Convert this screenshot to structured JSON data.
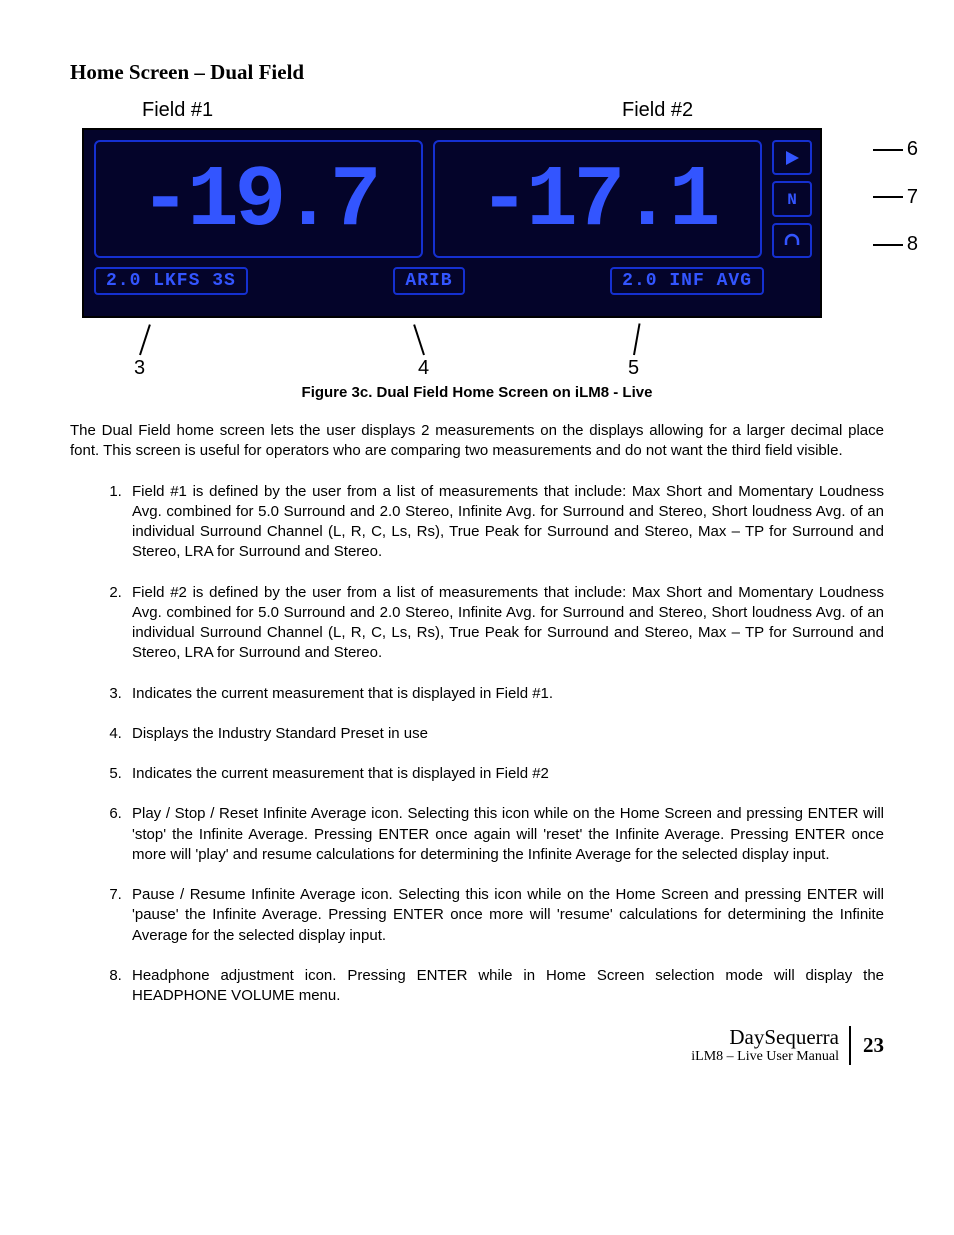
{
  "section_title": "Home Screen – Dual Field",
  "figure": {
    "field1_label": "Field #1",
    "field2_label": "Field #2",
    "field1_value": "-19.7",
    "field2_value": "-17.1",
    "tag_left": "2.0 LKFS 3S",
    "tag_center": "ARIB",
    "tag_right": "2.0 INF AVG",
    "callout_right": [
      "6",
      "7",
      "8"
    ],
    "callout_bottom": [
      "3",
      "4",
      "5"
    ],
    "caption": "Figure 3c.  Dual Field Home Screen on iLM8 - Live"
  },
  "intro": "The Dual Field home screen lets the user displays 2 measurements on the displays allowing for a larger decimal place font.  This screen is useful for operators who are comparing two measurements and do not want the third field visible.",
  "list": [
    "Field #1 is defined by the user from a list of measurements that include: Max Short and Momentary Loudness Avg. combined for 5.0 Surround and 2.0 Stereo, Infinite Avg. for Surround and Stereo, Short loudness Avg. of an individual Surround Channel (L, R, C, Ls, Rs), True Peak for Surround and Stereo, Max – TP for Surround and Stereo, LRA for Surround and Stereo.",
    "Field #2 is defined by the user from a list of measurements that include: Max Short and Momentary Loudness Avg. combined for 5.0 Surround and 2.0 Stereo, Infinite Avg. for Surround and Stereo, Short loudness Avg. of an individual Surround Channel (L, R, C, Ls, Rs), True Peak for Surround and Stereo, Max – TP for Surround and Stereo, LRA for Surround and Stereo.",
    "Indicates the current measurement that is displayed in Field #1.",
    "Displays the Industry Standard Preset in use",
    "Indicates the current measurement that is displayed in Field #2",
    "Play / Stop / Reset Infinite Average icon. Selecting this icon while on the Home Screen and pressing ENTER will 'stop' the Infinite Average.  Pressing ENTER once again will 'reset' the Infinite Average.  Pressing ENTER once more will 'play' and resume calculations for determining the Infinite Average for the selected display input.",
    "Pause / Resume Infinite Average icon.  Selecting this icon while on the Home Screen and pressing ENTER will 'pause' the Infinite Average.  Pressing ENTER once more will 'resume' calculations for determining the Infinite Average for the selected display input.",
    "Headphone adjustment icon. Pressing ENTER while in Home Screen selection mode will display the HEADPHONE VOLUME menu."
  ],
  "footer": {
    "brand": "DaySequerra",
    "manual": "iLM8 – Live User Manual",
    "page": "23"
  }
}
